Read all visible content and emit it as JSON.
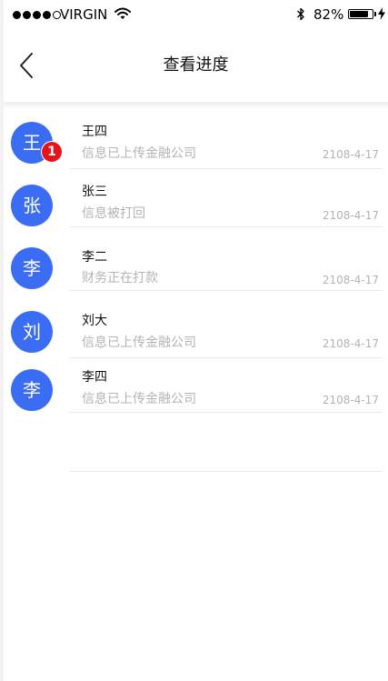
{
  "status_bar": {
    "carrier": "VIRGIN",
    "battery_percent": "82%",
    "battery_level": 0.82
  },
  "nav": {
    "title": "查看进度"
  },
  "items": [
    {
      "avatar": "王",
      "name": "王四",
      "message": "信息已上传金融公司",
      "date": "2108-4-17",
      "badge": "1"
    },
    {
      "avatar": "张",
      "name": "张三",
      "message": "信息被打回",
      "date": "2108-4-17"
    },
    {
      "avatar": "李",
      "name": "李二",
      "message": "财务正在打款",
      "date": "2108-4-17"
    },
    {
      "avatar": "刘",
      "name": "刘大",
      "message": "信息已上传金融公司",
      "date": "2108-4-17"
    },
    {
      "avatar": "李",
      "name": "李四",
      "message": "信息已上传金融公司",
      "date": "2108-4-17"
    }
  ],
  "colors": {
    "avatar_bg": "#3a6cf4",
    "badge_bg": "#e8141b"
  },
  "icons": {
    "back": "chevron-left-icon",
    "wifi": "wifi-icon",
    "bluetooth": "bluetooth-icon",
    "battery": "battery-icon",
    "charging": "lightning-icon"
  }
}
